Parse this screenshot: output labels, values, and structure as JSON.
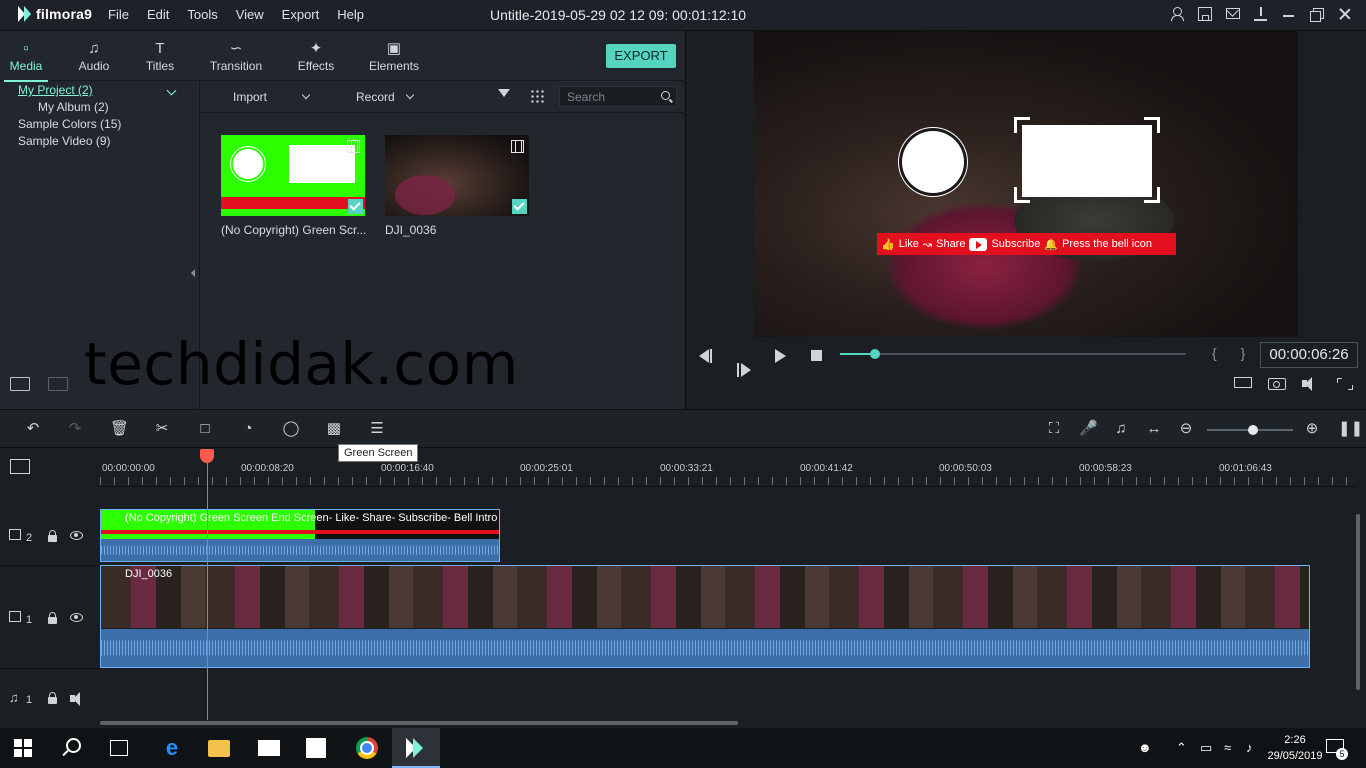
{
  "app": {
    "logo": "filmora9",
    "menu": [
      "File",
      "Edit",
      "Tools",
      "View",
      "Export",
      "Help"
    ],
    "window_title": "Untitle-2019-05-29 02 12 09:  00:01:12:10"
  },
  "tabs": [
    {
      "label": "Media",
      "icon": "folder-icon"
    },
    {
      "label": "Audio",
      "icon": "music-note-icon"
    },
    {
      "label": "Titles",
      "icon": "titles-icon"
    },
    {
      "label": "Transition",
      "icon": "transition-icon"
    },
    {
      "label": "Effects",
      "icon": "effects-icon"
    },
    {
      "label": "Elements",
      "icon": "image-icon"
    }
  ],
  "export_label": "EXPORT",
  "library": {
    "tree": [
      "My Project (2)",
      "My Album (2)",
      "Sample Colors (15)",
      "Sample Video (9)"
    ],
    "import_label": "Import",
    "record_label": "Record",
    "search_placeholder": "Search",
    "items": [
      {
        "name": "(No Copyright) Green Scr..."
      },
      {
        "name": "DJI_0036"
      }
    ]
  },
  "watermark": "techdidak.com",
  "preview": {
    "banner": {
      "like": "Like",
      "share": "Share",
      "subscribe": "Subscribe",
      "bell": "Press the bell icon"
    },
    "braces": "{ }",
    "timecode": "00:00:06:26",
    "progress_fraction": 0.1
  },
  "toolbar": {
    "tooltip": "Green Screen",
    "zoom_fraction": 0.53
  },
  "timeline": {
    "ruler": [
      "00:00:00:00",
      "00:00:08:20",
      "00:00:16:40",
      "00:00:25:01",
      "00:00:33:21",
      "00:00:41:42",
      "00:00:50:03",
      "00:00:58:23",
      "00:01:06:43"
    ],
    "tracks": [
      {
        "label": "2",
        "clip_title": "(No Copyright) Green Screen End Screen- Like- Share- Subscribe- Bell Intro [M"
      },
      {
        "label": "1",
        "clip_title": "DJI_0036"
      },
      {
        "label": "1"
      }
    ]
  },
  "taskbar": {
    "time": "2:26",
    "date": "29/05/2019",
    "notifications": "5"
  },
  "colors": {
    "accent": "#55d4c2",
    "playhead": "#ff5a4e",
    "green_screen": "#2bff00",
    "banner_red": "#e2101e"
  }
}
